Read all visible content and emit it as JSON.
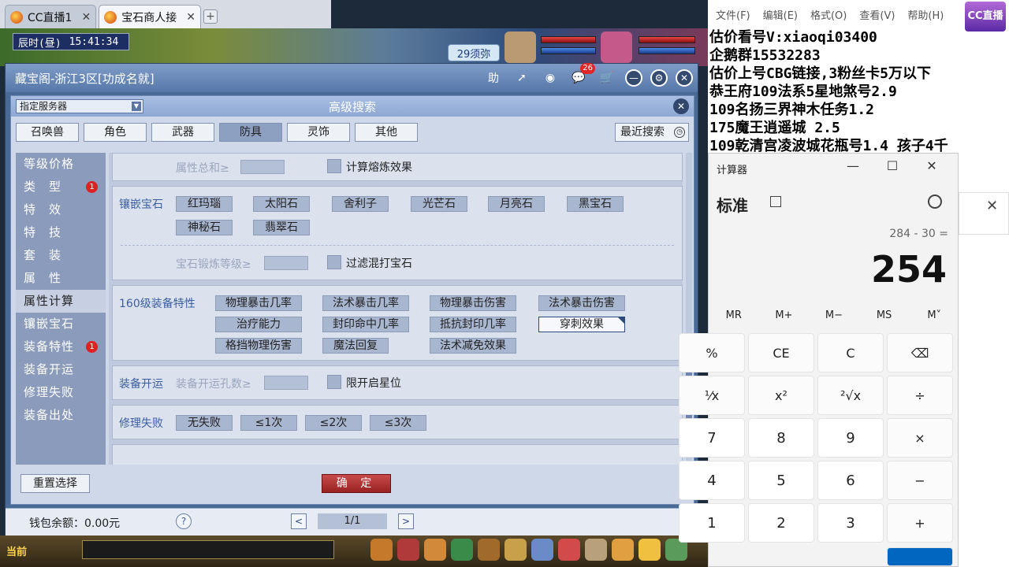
{
  "browser": {
    "tabs": [
      {
        "label": "CC直播1",
        "active": false
      },
      {
        "label": "宝石商人接",
        "active": true
      }
    ]
  },
  "game": {
    "clock_label": "辰时(昼)",
    "clock_time": "15:41:34",
    "server_badge": "29须弥"
  },
  "app": {
    "title": "藏宝阁-浙江3区[功成名就]",
    "buttons": {
      "help": "助",
      "share": "share-icon",
      "record": "record-icon",
      "message_count": "26",
      "cart": "cart-icon"
    }
  },
  "dialog": {
    "title": "高级搜索",
    "server_select": "指定服务器",
    "category_tabs": [
      "召唤兽",
      "角色",
      "武器",
      "防具",
      "灵饰",
      "其他"
    ],
    "active_tab": "防具",
    "recent_search": "最近搜索",
    "side_nav": [
      {
        "label": "等级价格",
        "badge": ""
      },
      {
        "label": "类　型",
        "badge": "1"
      },
      {
        "label": "特　效",
        "badge": ""
      },
      {
        "label": "特　技",
        "badge": ""
      },
      {
        "label": "套　装",
        "badge": ""
      },
      {
        "label": "属　性",
        "badge": ""
      },
      {
        "label": "属性计算",
        "badge": ""
      },
      {
        "label": "镶嵌宝石",
        "badge": ""
      },
      {
        "label": "装备特性",
        "badge": "1"
      },
      {
        "label": "装备开运",
        "badge": ""
      },
      {
        "label": "修理失败",
        "badge": ""
      },
      {
        "label": "装备出处",
        "badge": ""
      }
    ],
    "active_nav": "属性计算",
    "attr_total": {
      "label": "属性总和≥",
      "checkbox": "计算熔炼效果"
    },
    "gems": {
      "label": "镶嵌宝石",
      "items": [
        "红玛瑙",
        "太阳石",
        "舍利子",
        "光芒石",
        "月亮石",
        "黑宝石",
        "神秘石",
        "翡翠石"
      ],
      "forge_label": "宝石锻炼等级≥",
      "filter_checkbox": "过滤混打宝石"
    },
    "features": {
      "label": "160级装备特性",
      "items": [
        "物理暴击几率",
        "法术暴击几率",
        "物理暴击伤害",
        "法术暴击伤害",
        "治疗能力",
        "封印命中几率",
        "抵抗封印几率",
        "穿刺效果",
        "格挡物理伤害",
        "魔法回复",
        "法术减免效果"
      ],
      "selected": "穿刺效果"
    },
    "fortune": {
      "label": "装备开运",
      "holes_label": "装备开运孔数≥",
      "checkbox": "限开启星位"
    },
    "repair": {
      "label": "修理失败",
      "items": [
        "无失败",
        "≤1次",
        "≤2次",
        "≤3次"
      ]
    },
    "reset_button": "重置选择",
    "ok_button": "确 定"
  },
  "footer": {
    "wallet": "钱包余额：0.00元",
    "help": "?",
    "page": "1/1",
    "prev": "<",
    "next": ">"
  },
  "bottombar": {
    "now_label": "当前"
  },
  "notepad": {
    "menu": [
      "文件(F)",
      "编辑(E)",
      "格式(O)",
      "查看(V)",
      "帮助(H)"
    ],
    "lines": [
      "估价看号V:xiaoqi03400",
      "企鹅群15532283",
      "估价上号CBG链接,3粉丝卡5万以下",
      "恭王府109法系5星地煞号2.9",
      "109名扬三界神木任务1.2",
      "175魔王逍遥城 2.5",
      "109乾清宫凌波城花瓶号1.4 孩子4千"
    ],
    "logo": "CC直播"
  },
  "calculator": {
    "title": "计算器",
    "mode": "标准",
    "expression": "284 - 30 =",
    "display": "254",
    "memory": [
      "MR",
      "M+",
      "M−",
      "MS",
      "M˅"
    ],
    "keys": [
      [
        "%",
        "CE",
        "C",
        "⌫"
      ],
      [
        "¹⁄x",
        "x²",
        "²√x",
        "÷"
      ],
      [
        "7",
        "8",
        "9",
        "×"
      ],
      [
        "4",
        "5",
        "6",
        "−"
      ],
      [
        "1",
        "2",
        "3",
        "+"
      ]
    ]
  }
}
